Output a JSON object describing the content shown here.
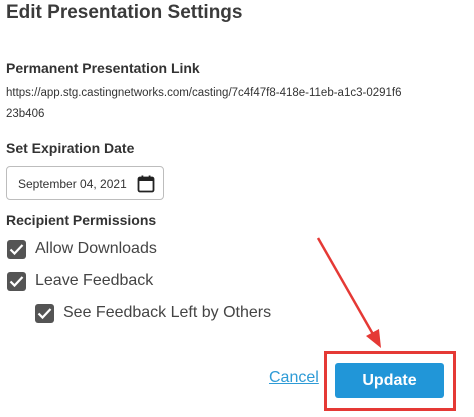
{
  "dialog": {
    "title": "Edit Presentation Settings"
  },
  "permanent_link": {
    "label": "Permanent Presentation Link",
    "url": "https://app.stg.castingnetworks.com/casting/7c4f47f8-418e-11eb-a1c3-0291f623b406"
  },
  "expiration": {
    "label": "Set Expiration Date",
    "value": "September 04, 2021",
    "icon": "calendar-icon"
  },
  "permissions": {
    "label": "Recipient Permissions",
    "items": [
      {
        "label": "Allow Downloads",
        "checked": true
      },
      {
        "label": "Leave Feedback",
        "checked": true
      },
      {
        "label": "See Feedback Left by Others",
        "checked": true
      }
    ]
  },
  "actions": {
    "cancel_label": "Cancel",
    "update_label": "Update"
  },
  "annotation": {
    "highlight_color": "#e53935"
  }
}
